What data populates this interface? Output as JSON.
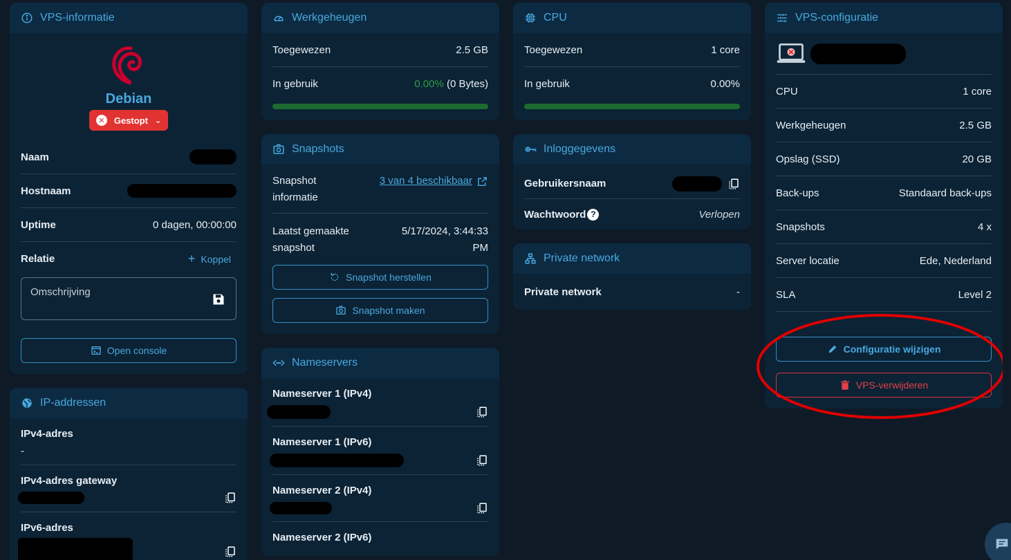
{
  "vps_info": {
    "title": "VPS-informatie",
    "os_name": "Debian",
    "status_label": "Gestopt",
    "rows": [
      {
        "key": "Naam"
      },
      {
        "key": "Hostnaam"
      },
      {
        "key": "Uptime",
        "value": "0 dagen, 00:00:00"
      },
      {
        "key": "Relatie",
        "value": "Koppel"
      }
    ],
    "description_placeholder": "Omschrijving",
    "console_label": "Open console"
  },
  "ip": {
    "title": "IP-addressen",
    "items": [
      {
        "label": "IPv4-adres",
        "value": "-"
      },
      {
        "label": "IPv4-adres gateway"
      },
      {
        "label": "IPv6-adres"
      }
    ]
  },
  "memory": {
    "title": "Werkgeheugen",
    "assigned_label": "Toegewezen",
    "assigned_value": "2.5 GB",
    "in_use_label": "In gebruik",
    "in_use_pct": "0.00%",
    "in_use_bytes": "(0 Bytes)",
    "usage_fraction": 0.0
  },
  "snapshots": {
    "title": "Snapshots",
    "info_label": "Snapshot informatie",
    "info_link": "3 van 4 beschikbaar",
    "last_label": "Laatst gemaakte snapshot",
    "last_value": "5/17/2024, 3:44:33 PM",
    "restore_label": "Snapshot herstellen",
    "make_label": "Snapshot maken"
  },
  "nameservers": {
    "title": "Nameservers",
    "items": [
      "Nameserver 1 (IPv4)",
      "Nameserver 1 (IPv6)",
      "Nameserver 2 (IPv4)",
      "Nameserver 2 (IPv6)"
    ]
  },
  "cpu": {
    "title": "CPU",
    "assigned_label": "Toegewezen",
    "assigned_value": "1 core",
    "in_use_label": "In gebruik",
    "in_use_pct": "0.00%",
    "usage_fraction": 0.0
  },
  "login": {
    "title": "Inloggegevens",
    "username_label": "Gebruikersnaam",
    "password_label": "Wachtwoord",
    "password_value": "Verlopen"
  },
  "private_network": {
    "title": "Private network",
    "label": "Private network",
    "value": "-"
  },
  "config": {
    "title": "VPS-configuratie",
    "rows": [
      {
        "key": "CPU",
        "value": "1 core"
      },
      {
        "key": "Werkgeheugen",
        "value": "2.5 GB"
      },
      {
        "key": "Opslag (SSD)",
        "value": "20 GB"
      },
      {
        "key": "Back-ups",
        "value": "Standaard back-ups"
      },
      {
        "key": "Snapshots",
        "value": "4 x"
      },
      {
        "key": "Server locatie",
        "value": "Ede, Nederland"
      },
      {
        "key": "SLA",
        "value": "Level 2"
      }
    ],
    "edit_label": "Configuratie wijzigen",
    "delete_label": "VPS-verwijderen"
  },
  "colors": {
    "accent": "#4aa8e0",
    "danger": "#e3404a",
    "success": "#2e9c46",
    "annotation": "#e00000"
  }
}
